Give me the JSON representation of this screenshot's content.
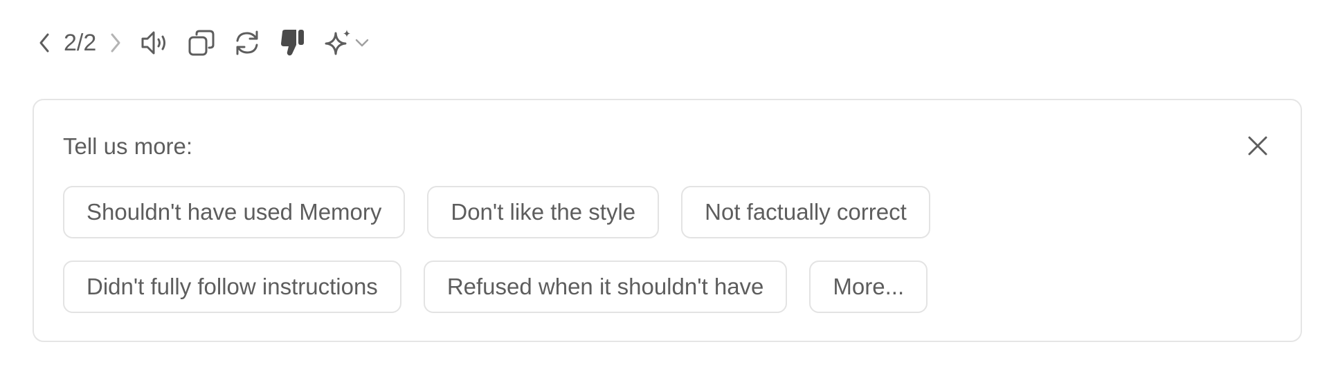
{
  "toolbar": {
    "pager": "2/2",
    "icons": {
      "prev": "chevron-left-icon",
      "next": "chevron-right-icon",
      "read_aloud": "speaker-icon",
      "copy": "copy-icon",
      "regenerate": "refresh-icon",
      "dislike": "thumbs-down-filled-icon",
      "model": "sparkle-icon",
      "model_dropdown": "chevron-down-icon"
    }
  },
  "feedback": {
    "title": "Tell us more:",
    "close_icon": "close-icon",
    "row1": [
      "Shouldn't have used Memory",
      "Don't like the style",
      "Not factually correct"
    ],
    "row2": [
      "Didn't fully follow instructions",
      "Refused when it shouldn't have",
      "More..."
    ]
  },
  "colors": {
    "text": "#5d5d5d",
    "disabled": "#b4b4b4",
    "border": "#e5e5e5"
  }
}
